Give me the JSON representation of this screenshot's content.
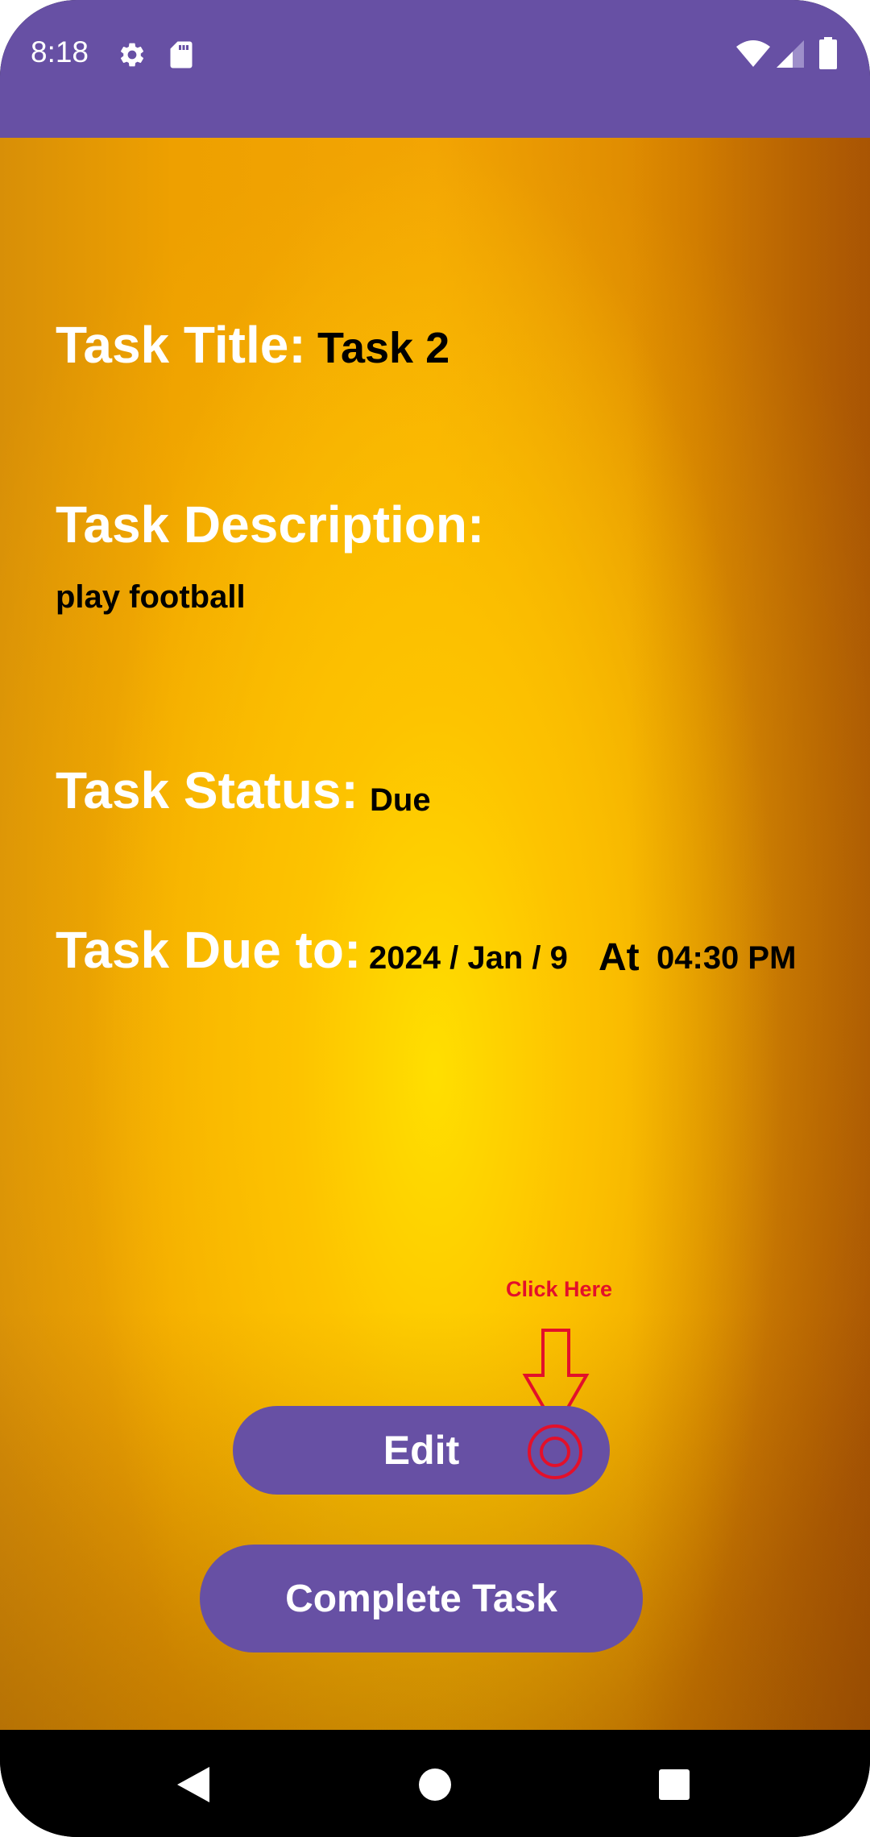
{
  "status_bar": {
    "time": "8:18",
    "icons": [
      "gear-icon",
      "sd-card-icon",
      "wifi-icon",
      "cellular-signal-icon",
      "battery-icon"
    ],
    "color": "#6750A4"
  },
  "task": {
    "title_label": "Task Title:",
    "title_value": "Task 2",
    "description_label": "Task Description:",
    "description_value": "play football",
    "status_label": "Task Status:",
    "status_value": "Due",
    "due_label": "Task Due to:",
    "due_date": "2024 / Jan / 9",
    "due_at": "At",
    "due_time": "04:30  PM"
  },
  "buttons": {
    "edit": "Edit",
    "complete": "Complete Task",
    "color": "#6750A4"
  },
  "annotation": {
    "hint_text": "Click Here",
    "color": "#e3102a"
  },
  "nav_bar": {
    "icons": [
      "back-icon",
      "home-icon",
      "recents-icon"
    ]
  }
}
